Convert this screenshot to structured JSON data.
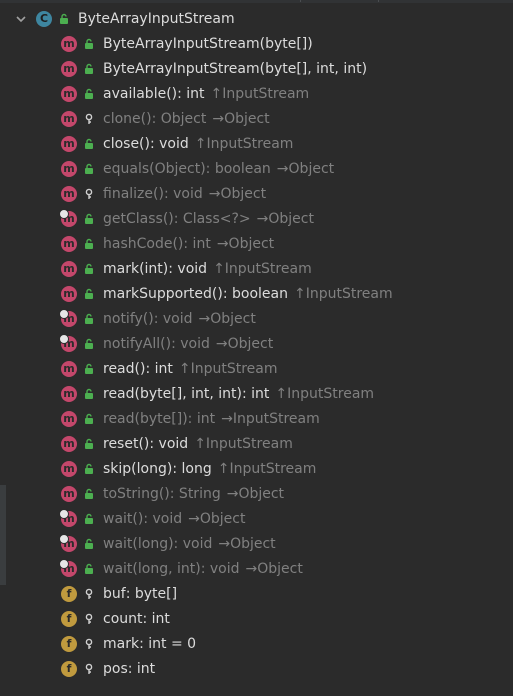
{
  "root": {
    "label": "ByteArrayInputStream",
    "icon": "class-icon"
  },
  "rows": [
    {
      "kind": "m",
      "vis": "public",
      "name": "ByteArrayInputStream(byte[])",
      "rest": "",
      "arrow": "",
      "parent": "",
      "dim": false,
      "pin": false
    },
    {
      "kind": "m",
      "vis": "public",
      "name": "ByteArrayInputStream(byte[], int, int)",
      "rest": "",
      "arrow": "",
      "parent": "",
      "dim": false,
      "pin": false
    },
    {
      "kind": "m",
      "vis": "public",
      "name": "available()",
      "rest": ": int",
      "arrow": "↑",
      "parent": "InputStream",
      "dim": false,
      "pin": false
    },
    {
      "kind": "m",
      "vis": "protected",
      "name": "clone()",
      "rest": ": Object",
      "arrow": "→",
      "parent": "Object",
      "dim": true,
      "pin": false
    },
    {
      "kind": "m",
      "vis": "public",
      "name": "close()",
      "rest": ": void",
      "arrow": "↑",
      "parent": "InputStream",
      "dim": false,
      "pin": false
    },
    {
      "kind": "m",
      "vis": "public",
      "name": "equals(Object)",
      "rest": ": boolean",
      "arrow": "→",
      "parent": "Object",
      "dim": true,
      "pin": false
    },
    {
      "kind": "m",
      "vis": "protected",
      "name": "finalize()",
      "rest": ": void",
      "arrow": "→",
      "parent": "Object",
      "dim": true,
      "pin": false
    },
    {
      "kind": "m",
      "vis": "public",
      "name": "getClass()",
      "rest": ": Class<?>",
      "arrow": "→",
      "parent": "Object",
      "dim": true,
      "pin": true
    },
    {
      "kind": "m",
      "vis": "public",
      "name": "hashCode()",
      "rest": ": int",
      "arrow": "→",
      "parent": "Object",
      "dim": true,
      "pin": false
    },
    {
      "kind": "m",
      "vis": "public",
      "name": "mark(int)",
      "rest": ": void",
      "arrow": "↑",
      "parent": "InputStream",
      "dim": false,
      "pin": false
    },
    {
      "kind": "m",
      "vis": "public",
      "name": "markSupported()",
      "rest": ": boolean",
      "arrow": "↑",
      "parent": "InputStream",
      "dim": false,
      "pin": false
    },
    {
      "kind": "m",
      "vis": "public",
      "name": "notify()",
      "rest": ": void",
      "arrow": "→",
      "parent": "Object",
      "dim": true,
      "pin": true
    },
    {
      "kind": "m",
      "vis": "public",
      "name": "notifyAll()",
      "rest": ": void",
      "arrow": "→",
      "parent": "Object",
      "dim": true,
      "pin": true
    },
    {
      "kind": "m",
      "vis": "public",
      "name": "read()",
      "rest": ": int",
      "arrow": "↑",
      "parent": "InputStream",
      "dim": false,
      "pin": false
    },
    {
      "kind": "m",
      "vis": "public",
      "name": "read(byte[], int, int)",
      "rest": ": int",
      "arrow": "↑",
      "parent": "InputStream",
      "dim": false,
      "pin": false
    },
    {
      "kind": "m",
      "vis": "public",
      "name": "read(byte[])",
      "rest": ": int",
      "arrow": "→",
      "parent": "InputStream",
      "dim": true,
      "pin": false
    },
    {
      "kind": "m",
      "vis": "public",
      "name": "reset()",
      "rest": ": void",
      "arrow": "↑",
      "parent": "InputStream",
      "dim": false,
      "pin": false
    },
    {
      "kind": "m",
      "vis": "public",
      "name": "skip(long)",
      "rest": ": long",
      "arrow": "↑",
      "parent": "InputStream",
      "dim": false,
      "pin": false
    },
    {
      "kind": "m",
      "vis": "public",
      "name": "toString()",
      "rest": ": String",
      "arrow": "→",
      "parent": "Object",
      "dim": true,
      "pin": false
    },
    {
      "kind": "m",
      "vis": "public",
      "name": "wait()",
      "rest": ": void",
      "arrow": "→",
      "parent": "Object",
      "dim": true,
      "pin": true
    },
    {
      "kind": "m",
      "vis": "public",
      "name": "wait(long)",
      "rest": ": void",
      "arrow": "→",
      "parent": "Object",
      "dim": true,
      "pin": true
    },
    {
      "kind": "m",
      "vis": "public",
      "name": "wait(long, int)",
      "rest": ": void",
      "arrow": "→",
      "parent": "Object",
      "dim": true,
      "pin": true
    },
    {
      "kind": "f",
      "vis": "protected",
      "name": "buf",
      "rest": ": byte[]",
      "arrow": "",
      "parent": "",
      "dim": false,
      "pin": false
    },
    {
      "kind": "f",
      "vis": "protected",
      "name": "count",
      "rest": ": int",
      "arrow": "",
      "parent": "",
      "dim": false,
      "pin": false
    },
    {
      "kind": "f",
      "vis": "protected",
      "name": "mark",
      "rest": ": int = 0",
      "arrow": "",
      "parent": "",
      "dim": false,
      "pin": false
    },
    {
      "kind": "f",
      "vis": "protected",
      "name": "pos",
      "rest": ": int",
      "arrow": "",
      "parent": "",
      "dim": false,
      "pin": false
    }
  ],
  "colors": {
    "background": "#2b2b2b",
    "methodBadge": "#c4476b",
    "fieldBadge": "#c09a3e",
    "classBadge": "#3e86a0",
    "publicLock": "#4caf50",
    "normalText": "#dcdcdc",
    "dimText": "#808080"
  }
}
